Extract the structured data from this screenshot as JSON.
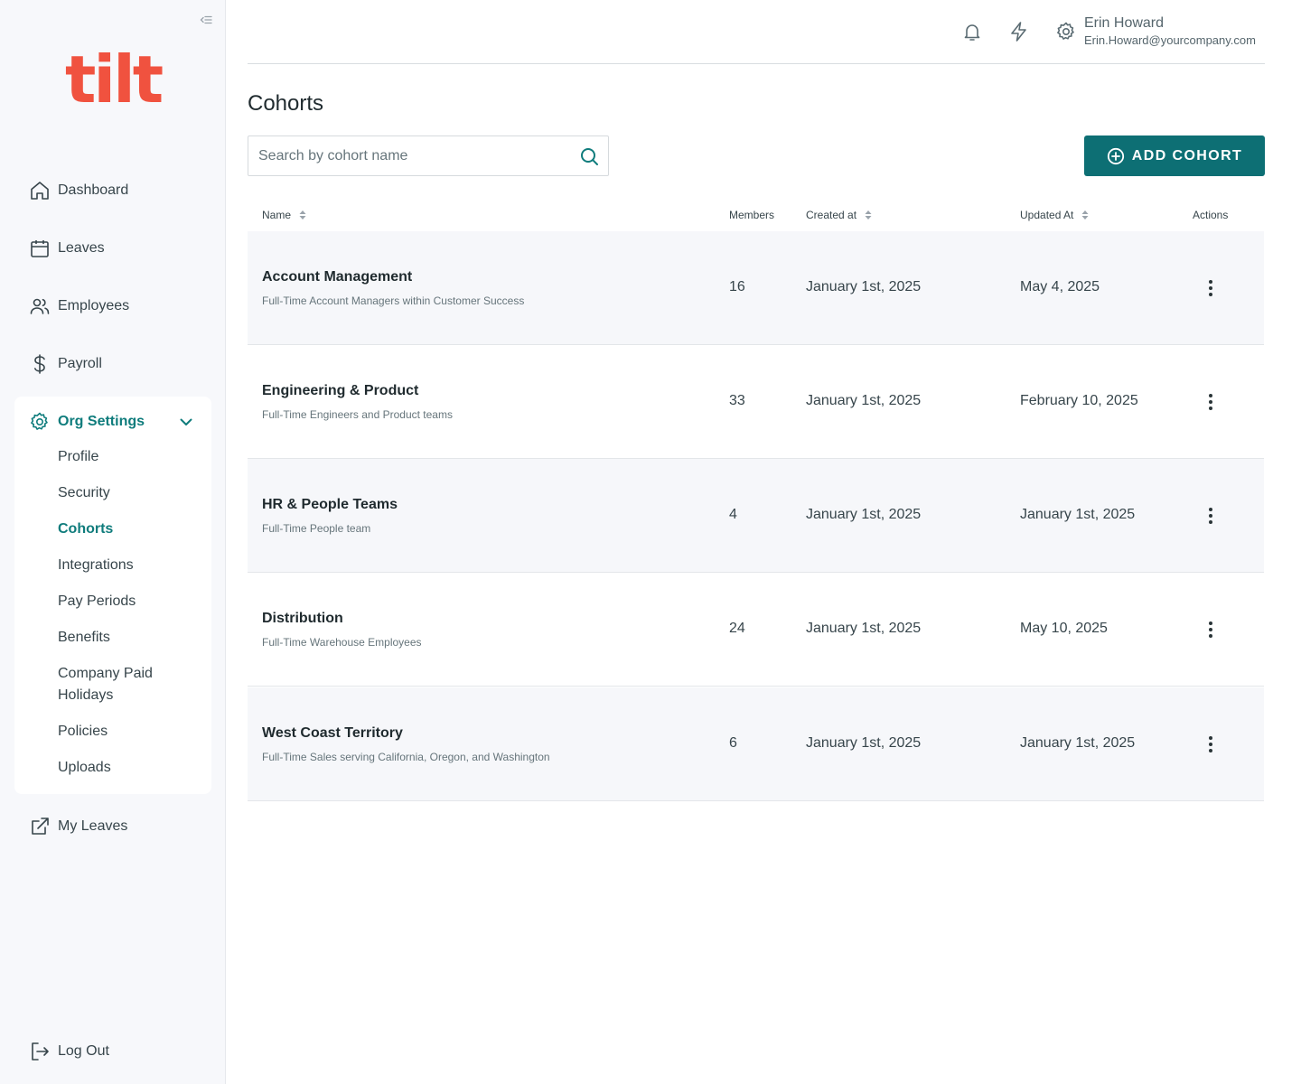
{
  "brand": {
    "logo_text": "tilt",
    "color": "#f0523f"
  },
  "colors": {
    "accent": "#0f7c7c",
    "button": "#0d6f74",
    "sidebar_bg": "#f7f8fb",
    "row_shade": "#f6f7fa"
  },
  "sidebar": {
    "nav": [
      {
        "label": "Dashboard",
        "icon": "home-icon"
      },
      {
        "label": "Leaves",
        "icon": "calendar-icon"
      },
      {
        "label": "Employees",
        "icon": "users-icon"
      },
      {
        "label": "Payroll",
        "icon": "dollar-icon"
      }
    ],
    "org_settings": {
      "label": "Org Settings",
      "icon": "gear-icon",
      "expanded": true,
      "items": [
        {
          "label": "Profile"
        },
        {
          "label": "Security"
        },
        {
          "label": "Cohorts",
          "active": true
        },
        {
          "label": "Integrations"
        },
        {
          "label": "Pay Periods"
        },
        {
          "label": "Benefits"
        },
        {
          "label": "Company Paid Holidays"
        },
        {
          "label": "Policies"
        },
        {
          "label": "Uploads"
        }
      ]
    },
    "my_leaves": {
      "label": "My Leaves",
      "icon": "external-link-icon"
    },
    "logout": {
      "label": "Log Out",
      "icon": "logout-icon"
    }
  },
  "header": {
    "icons": [
      "bell-icon",
      "lightning-icon",
      "gear-icon"
    ],
    "user": {
      "name": "Erin Howard",
      "email": "Erin.Howard@yourcompany.com"
    }
  },
  "main": {
    "title": "Cohorts",
    "search": {
      "placeholder": "Search by cohort name",
      "value": ""
    },
    "add_button": "ADD COHORT",
    "table": {
      "columns": [
        {
          "label": "Name",
          "sortable": true
        },
        {
          "label": "Members",
          "sortable": false
        },
        {
          "label": "Created at",
          "sortable": true
        },
        {
          "label": "Updated At",
          "sortable": true
        },
        {
          "label": "Actions",
          "sortable": false
        }
      ],
      "rows": [
        {
          "name": "Account Management",
          "description": "Full-Time Account Managers within Customer Success",
          "members": "16",
          "created": "January 1st, 2025",
          "updated": "May 4, 2025"
        },
        {
          "name": "Engineering & Product",
          "description": "Full-Time Engineers and Product teams",
          "members": "33",
          "created": "January 1st, 2025",
          "updated": "February 10, 2025"
        },
        {
          "name": "HR & People Teams",
          "description": "Full-Time People team",
          "members": "4",
          "created": "January 1st, 2025",
          "updated": "January 1st, 2025"
        },
        {
          "name": "Distribution",
          "description": "Full-Time Warehouse Employees",
          "members": "24",
          "created": "January 1st, 2025",
          "updated": "May 10, 2025"
        },
        {
          "name": "West Coast Territory",
          "description": "Full-Time Sales serving California, Oregon, and Washington",
          "members": "6",
          "created": "January 1st, 2025",
          "updated": "January 1st, 2025"
        }
      ]
    }
  }
}
